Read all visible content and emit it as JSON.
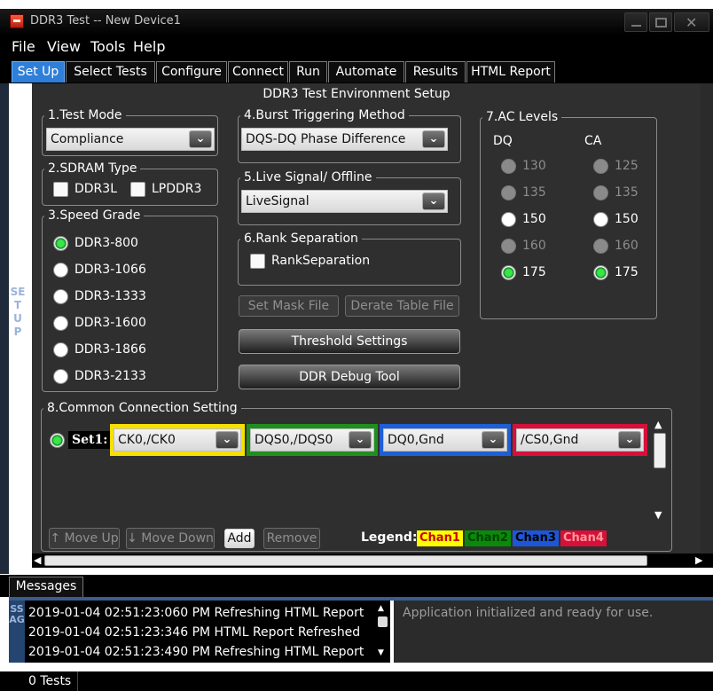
{
  "window": {
    "title": "DDR3 Test -- New Device1"
  },
  "menu": [
    "File",
    "View",
    "Tools",
    "Help"
  ],
  "tabs": [
    "Set Up",
    "Select Tests",
    "Configure",
    "Connect",
    "Run",
    "Automate",
    "Results",
    "HTML Report"
  ],
  "side_label": "SET UP",
  "panel_title": "DDR3 Test Environment Setup",
  "test_mode": {
    "title": "1.Test Mode",
    "value": "Compliance"
  },
  "sdram": {
    "title": "2.SDRAM Type",
    "options": [
      "DDR3L",
      "LPDDR3"
    ]
  },
  "speed": {
    "title": "3.Speed Grade",
    "options": [
      "DDR3-800",
      "DDR3-1066",
      "DDR3-1333",
      "DDR3-1600",
      "DDR3-1866",
      "DDR3-2133"
    ],
    "selected": "DDR3-800"
  },
  "burst": {
    "title": "4.Burst Triggering Method",
    "value": "DQS-DQ Phase Difference"
  },
  "live": {
    "title": "5.Live Signal/ Offline",
    "value": "LiveSignal"
  },
  "rank": {
    "title": "6.Rank Separation",
    "checkbox_label": "RankSeparation"
  },
  "buttons": {
    "set_mask": "Set Mask File",
    "derate": "Derate Table File",
    "threshold": "Threshold Settings",
    "debug": "DDR Debug Tool"
  },
  "ac": {
    "title": "7.AC Levels",
    "dq_header": "DQ",
    "ca_header": "CA",
    "dq": [
      "130",
      "135",
      "150",
      "160",
      "175"
    ],
    "ca": [
      "125",
      "135",
      "150",
      "160",
      "175"
    ],
    "selected": "175"
  },
  "connection": {
    "title": "8.Common Connection Setting",
    "set_label": "Set1:",
    "channels": [
      {
        "value": "CK0,/CK0",
        "color": "#f5e000"
      },
      {
        "value": "DQS0,/DQS0",
        "color": "#1f8f1f"
      },
      {
        "value": "DQ0,Gnd",
        "color": "#1f5fd6"
      },
      {
        "value": "/CS0,Gnd",
        "color": "#d6103a"
      }
    ],
    "move_up": "↑ Move Up",
    "move_down": "↓ Move Down",
    "add": "Add",
    "remove": "Remove",
    "legend_label": "Legend:",
    "legend": [
      {
        "name": "Chan1",
        "bg": "#ffff00",
        "fg": "#cc0000"
      },
      {
        "name": "Chan2",
        "bg": "#0a8a0a",
        "fg": "#004400"
      },
      {
        "name": "Chan3",
        "bg": "#1d56d6",
        "fg": "#000000"
      },
      {
        "name": "Chan4",
        "bg": "#d6103a",
        "fg": "#ff9999"
      }
    ]
  },
  "messages": {
    "tab": "Messages",
    "side": "SSAG",
    "log": [
      "2019-01-04 02:51:23:060 PM Refreshing HTML Report",
      "2019-01-04 02:51:23:346 PM HTML Report Refreshed",
      "2019-01-04 02:51:23:490 PM Refreshing HTML Report"
    ],
    "status": "Application initialized and ready for use."
  },
  "statusbar": {
    "tests": "0 Tests"
  }
}
